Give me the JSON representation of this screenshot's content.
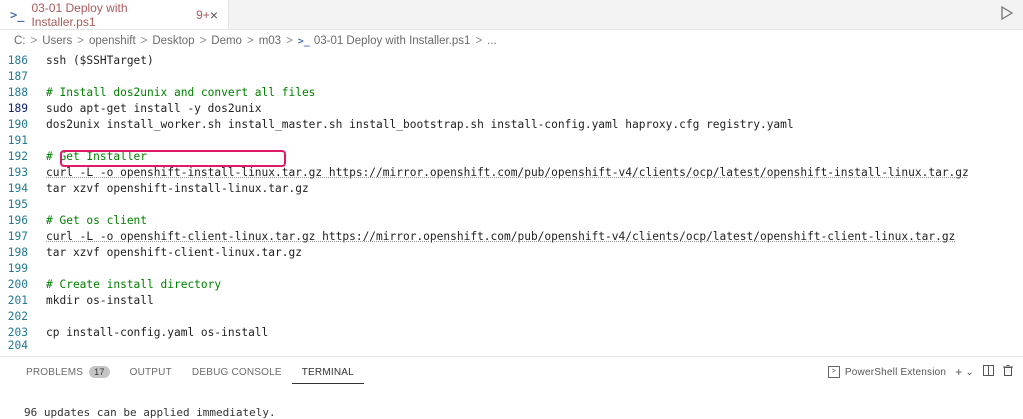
{
  "tab": {
    "icon": "powershell-icon",
    "title": "03-01 Deploy with Installer.ps1",
    "problems": "9+",
    "close": "×"
  },
  "run_button_icon": "run-icon",
  "breadcrumb": {
    "parts": [
      "C:",
      "Users",
      "openshift",
      "Desktop",
      "Demo",
      "m03"
    ],
    "file": "03-01 Deploy with Installer.ps1",
    "ellipsis": "..."
  },
  "editor": {
    "lines": [
      {
        "n": "186",
        "text": "ssh ($SSHTarget)"
      },
      {
        "n": "187",
        "text": ""
      },
      {
        "n": "188",
        "text": "# Install dos2unix and convert all files"
      },
      {
        "n": "189",
        "text": "sudo apt-get install -y dos2unix"
      },
      {
        "n": "190",
        "text": "dos2unix install_worker.sh install_master.sh install_bootstrap.sh install-config.yaml haproxy.cfg registry.yaml"
      },
      {
        "n": "191",
        "text": ""
      },
      {
        "n": "192",
        "text": "# Get Installer"
      },
      {
        "n": "193",
        "text": "curl -L -o openshift-install-linux.tar.gz https://mirror.openshift.com/pub/openshift-v4/clients/ocp/latest/openshift-install-linux.tar.gz"
      },
      {
        "n": "194",
        "text": "tar xzvf openshift-install-linux.tar.gz"
      },
      {
        "n": "195",
        "text": ""
      },
      {
        "n": "196",
        "text": "# Get os client"
      },
      {
        "n": "197",
        "text": "curl -L -o openshift-client-linux.tar.gz https://mirror.openshift.com/pub/openshift-v4/clients/ocp/latest/openshift-client-linux.tar.gz"
      },
      {
        "n": "198",
        "text": "tar xzvf openshift-client-linux.tar.gz"
      },
      {
        "n": "199",
        "text": ""
      },
      {
        "n": "200",
        "text": "# Create install directory"
      },
      {
        "n": "201",
        "text": "mkdir os-install"
      },
      {
        "n": "202",
        "text": ""
      },
      {
        "n": "203",
        "text": "cp install-config.yaml os-install"
      },
      {
        "n": "204",
        "text": ""
      }
    ]
  },
  "panel": {
    "problems": "PROBLEMS",
    "problems_count": "17",
    "output": "OUTPUT",
    "debug": "DEBUG CONSOLE",
    "terminal": "TERMINAL",
    "shell": "PowerShell Extension",
    "plus": "+",
    "chev": "⌄"
  },
  "terminal": {
    "partial": "96 updates can be applied immediately."
  }
}
